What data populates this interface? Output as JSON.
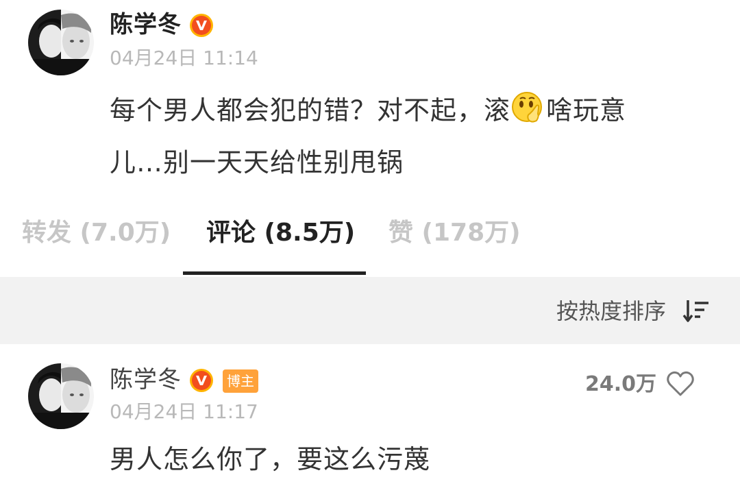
{
  "post": {
    "author_name": "陈学冬",
    "verified_badge_icon": "verified-v-icon",
    "timestamp": "04月24日 11:14",
    "content_part1": "每个男人都会犯的错？对不起，滚",
    "emoji_icon": "shush-emoji-icon",
    "content_part2": "啥玩意",
    "content_line2": "儿…别一天天给性别甩锅"
  },
  "tabs": [
    {
      "label": "转发 (7.0万)",
      "active": false
    },
    {
      "label": "评论 (8.5万)",
      "active": true
    },
    {
      "label": "赞 (178万)",
      "active": false
    }
  ],
  "sort": {
    "label": "按热度排序",
    "icon": "sort-descending-icon"
  },
  "comment": {
    "author_name": "陈学冬",
    "author_tag": "博主",
    "timestamp": "04月24日 11:17",
    "like_count": "24.0万",
    "like_icon": "heart-outline-icon",
    "text": "男人怎么你了，要这么污蔑"
  },
  "colors": {
    "verified_badge": "#f24e1e",
    "author_tag_bg": "#ffa23a",
    "inactive_tab": "#c6c6c6",
    "sortbar_bg": "#f2f2f2"
  }
}
